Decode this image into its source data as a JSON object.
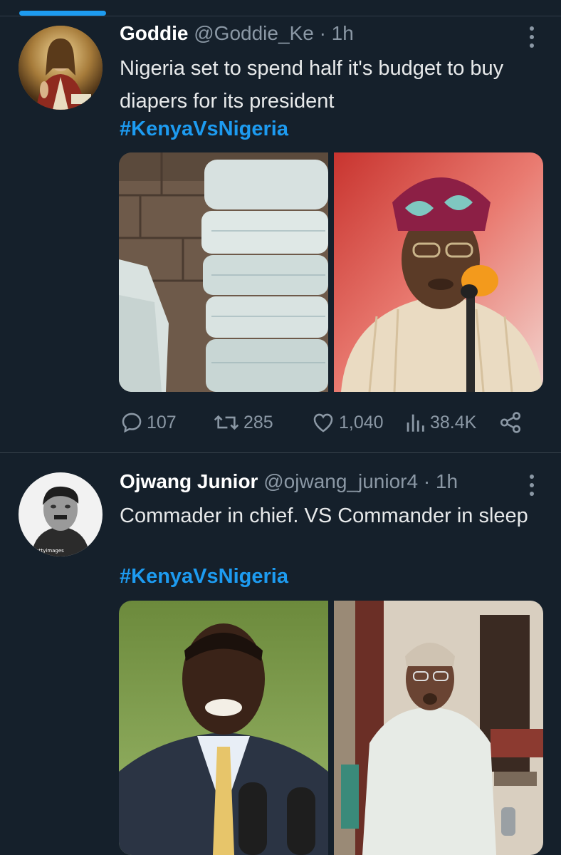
{
  "colors": {
    "background": "#15202b",
    "accent": "#1d9bf0",
    "muted": "#8b98a5",
    "text": "#e7e9ea"
  },
  "tweets": [
    {
      "name": "Goddie",
      "handle": "@Goddie_Ke",
      "separator": "·",
      "time": "1h",
      "text": "Nigeria set to spend half it's budget to buy diapers for its president",
      "hashtag": "#KenyaVsNigeria",
      "avatar": "religious-portrait-avatar",
      "media": [
        "stacked-diapers-photo",
        "man-in-cap-at-microphone-photo"
      ],
      "actions": {
        "reply_count": "107",
        "retweet_count": "285",
        "like_count": "1,040",
        "view_count": "38.4K"
      }
    },
    {
      "name": "Ojwang Junior",
      "handle": "@ojwang_junior4",
      "separator": "·",
      "time": "1h",
      "text": "Commader in chief. VS Commander in sleep",
      "hashtag": "#KenyaVsNigeria",
      "avatar": "black-and-white-portrait-avatar",
      "media": [
        "man-in-suit-at-microphones-photo",
        "elderly-man-in-white-gown-photo"
      ]
    }
  ]
}
